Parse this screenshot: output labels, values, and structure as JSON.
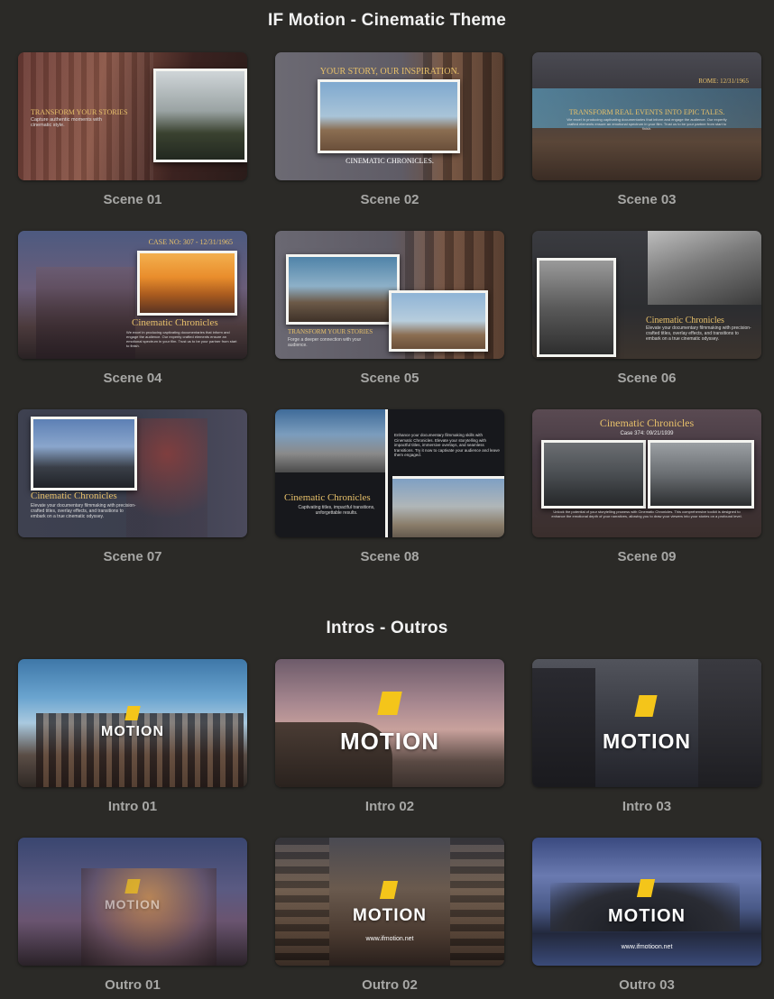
{
  "sections": {
    "scenes_title": "IF Motion - Cinematic Theme",
    "intros_title": "Intros - Outros"
  },
  "scenes": [
    {
      "label": "Scene 01",
      "headline": "TRANSFORM YOUR STORIES",
      "body": "Capture authentic moments with cinematic style."
    },
    {
      "label": "Scene 02",
      "headline": "YOUR STORY, OUR INSPIRATION.",
      "footer": "CINEMATIC CHRONICLES."
    },
    {
      "label": "Scene 03",
      "date": "ROME: 12/31/1965",
      "headline": "TRANSFORM REAL EVENTS INTO EPIC TALES.",
      "body": "We excel in producing captivating documentaries that inform and engage the audience. Our expertly crafted elements ensure an emotional spectrum in your film. Trust us to be your partner from start to finish."
    },
    {
      "label": "Scene 04",
      "case": "CASE NO: 307 - 12/31/1965",
      "headline": "Cinematic Chronicles",
      "body": "We excel in producing captivating documentaries that inform and engage the audience. Our expertly crafted elements ensure an emotional spectrum in your film. Trust us to be your partner from start to finish."
    },
    {
      "label": "Scene 05",
      "headline": "TRANSFORM YOUR STORIES",
      "body": "Forge a deeper connection with your audience."
    },
    {
      "label": "Scene 06",
      "headline": "Cinematic Chronicles",
      "body": "Elevate your documentary filmmaking with precision-crafted titles, overlay effects, and transitions to embark on a true cinematic odyssey."
    },
    {
      "label": "Scene 07",
      "headline": "Cinematic Chronicles",
      "body": "Elevate your documentary filmmaking with precision-crafted titles, overlay effects, and transitions to embark on a true cinematic odyssey."
    },
    {
      "label": "Scene 08",
      "headline": "Cinematic Chronicles",
      "body": "Captivating titles, impactful transitions, unforgettable results.",
      "side": "Enhance your documentary filmmaking skills with Cinematic Chronicles. Elevate your storytelling with impactful titles, immersive overlays, and seamless transitions. Try it now to captivate your audience and leave them engaged."
    },
    {
      "label": "Scene 09",
      "headline": "Cinematic Chronicles",
      "case": "Case 374: 09/21/1939",
      "body": "Unlock the potential of your storytelling prowess with Cinematic Chronicles. This comprehensive toolkit is designed to enhance the emotional depth of your narratives, allowing you to draw your viewers into your stories on a profound level."
    }
  ],
  "intros": [
    {
      "label": "Intro 01",
      "logo": "MOTION"
    },
    {
      "label": "Intro 02",
      "logo": "MOTION"
    },
    {
      "label": "Intro 03",
      "logo": "MOTION"
    },
    {
      "label": "Outro 01",
      "logo": "MOTION"
    },
    {
      "label": "Outro 02",
      "logo": "MOTION",
      "site": "www.ifmotion.net"
    },
    {
      "label": "Outro 03",
      "logo": "MOTION",
      "site": "www.ifmotioon.net"
    }
  ],
  "colors": {
    "background": "#2b2a27",
    "caption": "#a7a7a5",
    "gold": "#e7c06a",
    "logo_yellow": "#f4c51a"
  }
}
